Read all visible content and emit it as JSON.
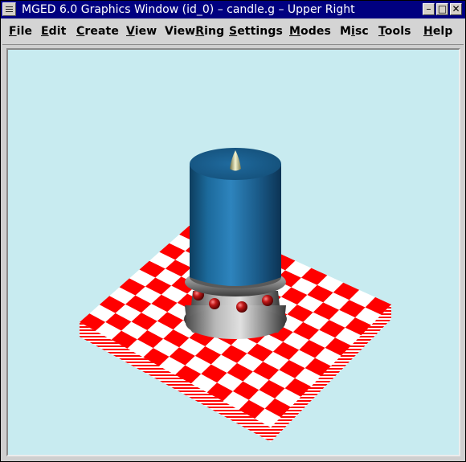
{
  "window": {
    "title": "MGED 6.0 Graphics Window (id_0) – candle.g – Upper Right",
    "minimize_glyph": "–",
    "maximize_glyph": "□",
    "close_glyph": "✕"
  },
  "menubar": {
    "items": [
      {
        "label": "File",
        "mnemonic": "F"
      },
      {
        "label": "Edit",
        "mnemonic": "E"
      },
      {
        "label": "Create",
        "mnemonic": "C"
      },
      {
        "label": "View",
        "mnemonic": "V"
      },
      {
        "label": "ViewRing",
        "mnemonic": "R"
      },
      {
        "label": "Settings",
        "mnemonic": "S"
      },
      {
        "label": "Modes",
        "mnemonic": "M"
      },
      {
        "label": "Misc",
        "mnemonic": "i"
      },
      {
        "label": "Tools",
        "mnemonic": "T"
      },
      {
        "label": "Help",
        "mnemonic": "H"
      }
    ]
  },
  "colors": {
    "titlebar": "#000080",
    "viewport_bg": "#c8ebf0",
    "checker_red": "#ff0000",
    "checker_white": "#ffffff",
    "candle_blue": "#1a5e8c",
    "bead_red": "#a01010",
    "holder_gray": "#8a8a8a"
  },
  "scene": {
    "model": "candle.g",
    "objects": [
      "checkerboard-base",
      "candle-holder",
      "candle-body",
      "candle-wick"
    ]
  }
}
